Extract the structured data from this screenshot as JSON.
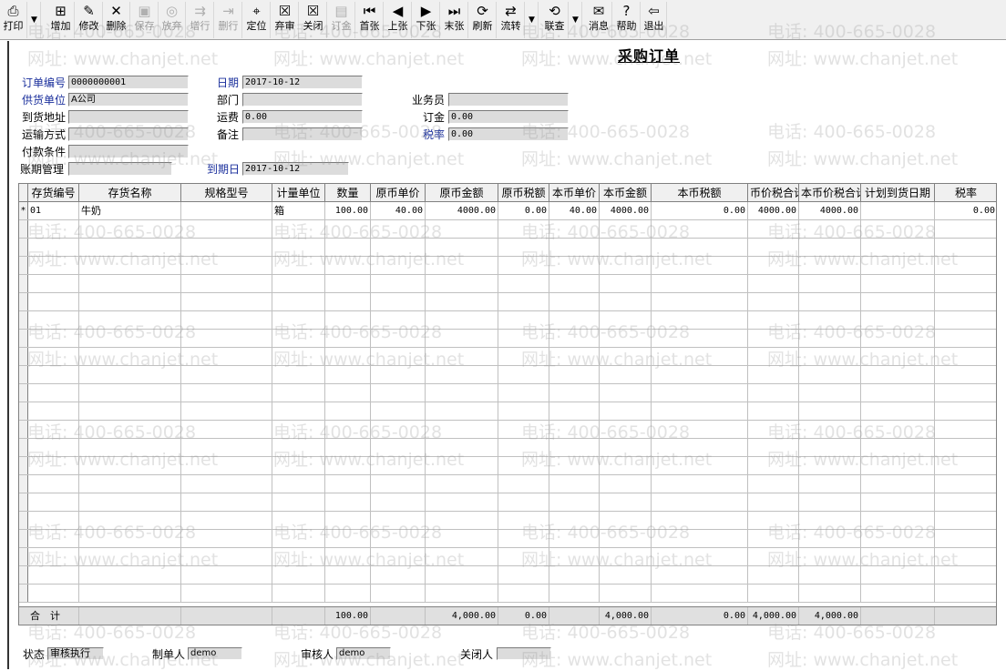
{
  "toolbar": {
    "buttons": [
      {
        "label": "打印",
        "icon": "printer-icon",
        "glyph": "⎙",
        "enabled": true
      },
      {
        "label": "增加",
        "icon": "add-icon",
        "glyph": "⊞",
        "enabled": true
      },
      {
        "label": "修改",
        "icon": "edit-icon",
        "glyph": "✎",
        "enabled": true
      },
      {
        "label": "删除",
        "icon": "delete-icon",
        "glyph": "✕",
        "enabled": true
      },
      {
        "label": "保存",
        "icon": "save-icon",
        "glyph": "▣",
        "enabled": false
      },
      {
        "label": "放弃",
        "icon": "discard-icon",
        "glyph": "◎",
        "enabled": false
      },
      {
        "label": "增行",
        "icon": "add-row-icon",
        "glyph": "⇉",
        "enabled": false
      },
      {
        "label": "删行",
        "icon": "delete-row-icon",
        "glyph": "⇥",
        "enabled": false
      },
      {
        "label": "定位",
        "icon": "locate-icon",
        "glyph": "⌖",
        "enabled": true
      },
      {
        "label": "弃审",
        "icon": "unapprove-icon",
        "glyph": "☒",
        "enabled": true
      },
      {
        "label": "关闭",
        "icon": "close-doc-icon",
        "glyph": "☒",
        "enabled": true
      },
      {
        "label": "订金",
        "icon": "deposit-icon",
        "glyph": "▤",
        "enabled": false
      },
      {
        "label": "首张",
        "icon": "first-record-icon",
        "glyph": "⏮",
        "enabled": true
      },
      {
        "label": "上张",
        "icon": "previous-record-icon",
        "glyph": "◀",
        "enabled": true
      },
      {
        "label": "下张",
        "icon": "next-record-icon",
        "glyph": "▶",
        "enabled": true
      },
      {
        "label": "末张",
        "icon": "last-record-icon",
        "glyph": "⏭",
        "enabled": true
      },
      {
        "label": "刷新",
        "icon": "refresh-icon",
        "glyph": "⟳",
        "enabled": true
      },
      {
        "label": "流转",
        "icon": "flow-icon",
        "glyph": "⇄",
        "enabled": true
      },
      {
        "label": "联查",
        "icon": "linked-query-icon",
        "glyph": "⟲",
        "enabled": true
      },
      {
        "label": "消息",
        "icon": "message-icon",
        "glyph": "✉",
        "enabled": true
      },
      {
        "label": "帮助",
        "icon": "help-icon",
        "glyph": "?",
        "enabled": true
      },
      {
        "label": "退出",
        "icon": "exit-icon",
        "glyph": "⇦",
        "enabled": true
      }
    ]
  },
  "form": {
    "title": "采购订单",
    "fields": {
      "order_no": {
        "label": "订单编号",
        "value": "0000000001"
      },
      "date": {
        "label": "日期",
        "value": "2017-10-12"
      },
      "supplier": {
        "label": "供货单位",
        "value": "A公司"
      },
      "department": {
        "label": "部门",
        "value": ""
      },
      "salesperson": {
        "label": "业务员",
        "value": ""
      },
      "delivery_address": {
        "label": "到货地址",
        "value": ""
      },
      "freight": {
        "label": "运费",
        "value": "0.00"
      },
      "deposit": {
        "label": "订金",
        "value": "0.00"
      },
      "transport": {
        "label": "运输方式",
        "value": ""
      },
      "remark": {
        "label": "备注",
        "value": ""
      },
      "tax_rate": {
        "label": "税率",
        "value": "0.00"
      },
      "payment_terms": {
        "label": "付款条件",
        "value": ""
      },
      "credit_period": {
        "label": "账期管理",
        "value": ""
      },
      "due_date": {
        "label": "到期日",
        "value": "2017-10-12"
      }
    }
  },
  "grid": {
    "columns": [
      "存货编号",
      "存货名称",
      "规格型号",
      "计量单位",
      "数量",
      "原币单价",
      "原币金额",
      "原币税额",
      "本币单价",
      "本币金额",
      "本币税额",
      "币价税合计",
      "本币价税合计",
      "计划到货日期",
      "税率"
    ],
    "rows": [
      {
        "marker": "*",
        "cells": [
          "01",
          "牛奶",
          "",
          "箱",
          "100.00",
          "40.00",
          "4000.00",
          "0.00",
          "40.00",
          "4000.00",
          "0.00",
          "4000.00",
          "4000.00",
          "",
          "0.00"
        ]
      }
    ],
    "totals": {
      "label": "合　计",
      "cells": [
        "",
        "",
        "",
        "",
        "100.00",
        "",
        "4,000.00",
        "0.00",
        "",
        "4,000.00",
        "0.00",
        "4,000.00",
        "4,000.00",
        "",
        ""
      ]
    }
  },
  "status": {
    "state_label": "状态",
    "state_value": "审核执行",
    "maker_label": "制单人",
    "maker_value": "demo",
    "auditor_label": "审核人",
    "auditor_value": "demo",
    "closer_label": "关闭人",
    "closer_value": ""
  },
  "watermark": {
    "phone": "电话: 400-665-0028",
    "site": "网址: www.chanjet.net"
  }
}
